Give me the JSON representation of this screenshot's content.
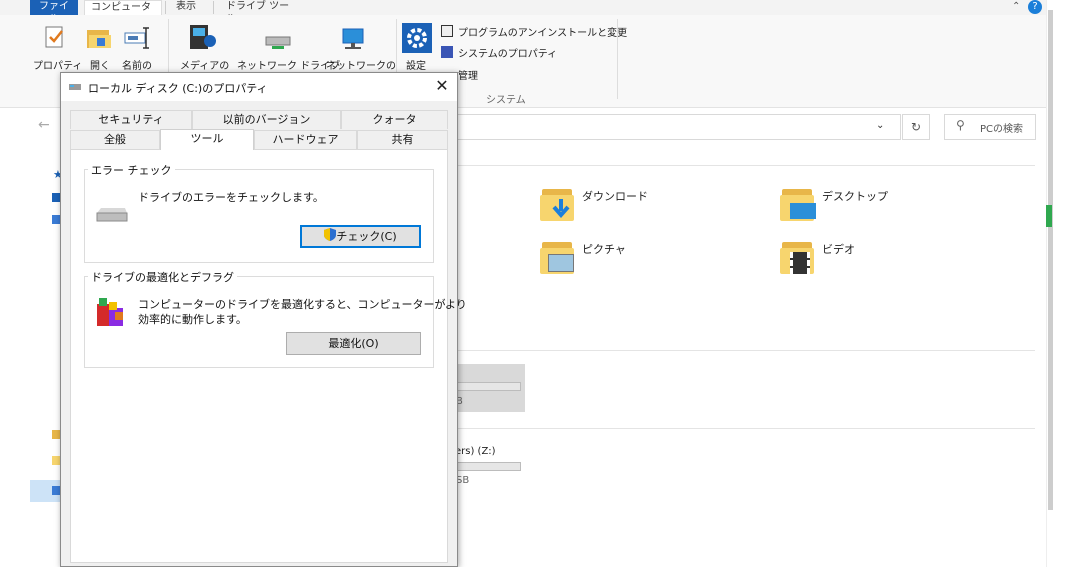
{
  "ribbon": {
    "tabs": [
      "ファイル",
      "コンピューター",
      "表示",
      "ドライブ ツール"
    ],
    "buttons": {
      "properties": "プロパティ",
      "open": "開く",
      "rename": "名前の",
      "media": "メディアの",
      "network_drive": "ネットワーク ドライブ",
      "network_location": "ネットワークの",
      "settings": "設定"
    },
    "system_items": [
      "プログラムのアンインストールと変更",
      "システムのプロパティ",
      "管理"
    ],
    "system_group_label": "システム"
  },
  "search": {
    "placeholder": "PCの検索"
  },
  "folders": [
    {
      "name": "ダウンロード"
    },
    {
      "name": "デスクトップ"
    },
    {
      "name": "ピクチャ"
    },
    {
      "name": "ビデオ"
    }
  ],
  "drives": {
    "drive1_size_fragment": "B",
    "drive2_label_fragment": "ers) (Z:)",
    "drive2_size_fragment": "SB"
  },
  "dialog": {
    "title": "ローカル ディスク (C:)のプロパティ",
    "tabs_row1": [
      "セキュリティ",
      "以前のバージョン",
      "クォータ"
    ],
    "tabs_row2": [
      "全般",
      "ツール",
      "ハードウェア",
      "共有"
    ],
    "active_tab": "ツール",
    "error_check": {
      "group_title": "エラー チェック",
      "description": "ドライブのエラーをチェックします。",
      "button": "チェック(C)"
    },
    "optimize": {
      "group_title": "ドライブの最適化とデフラグ",
      "description_line1": "コンピューターのドライブを最適化すると、コンピューターがより",
      "description_line2": "効率的に動作します。",
      "button": "最適化(O)"
    }
  },
  "colors": {
    "file_tab": "#1b61b6",
    "focus_border": "#0078d7",
    "folder": "#f7d56e"
  }
}
